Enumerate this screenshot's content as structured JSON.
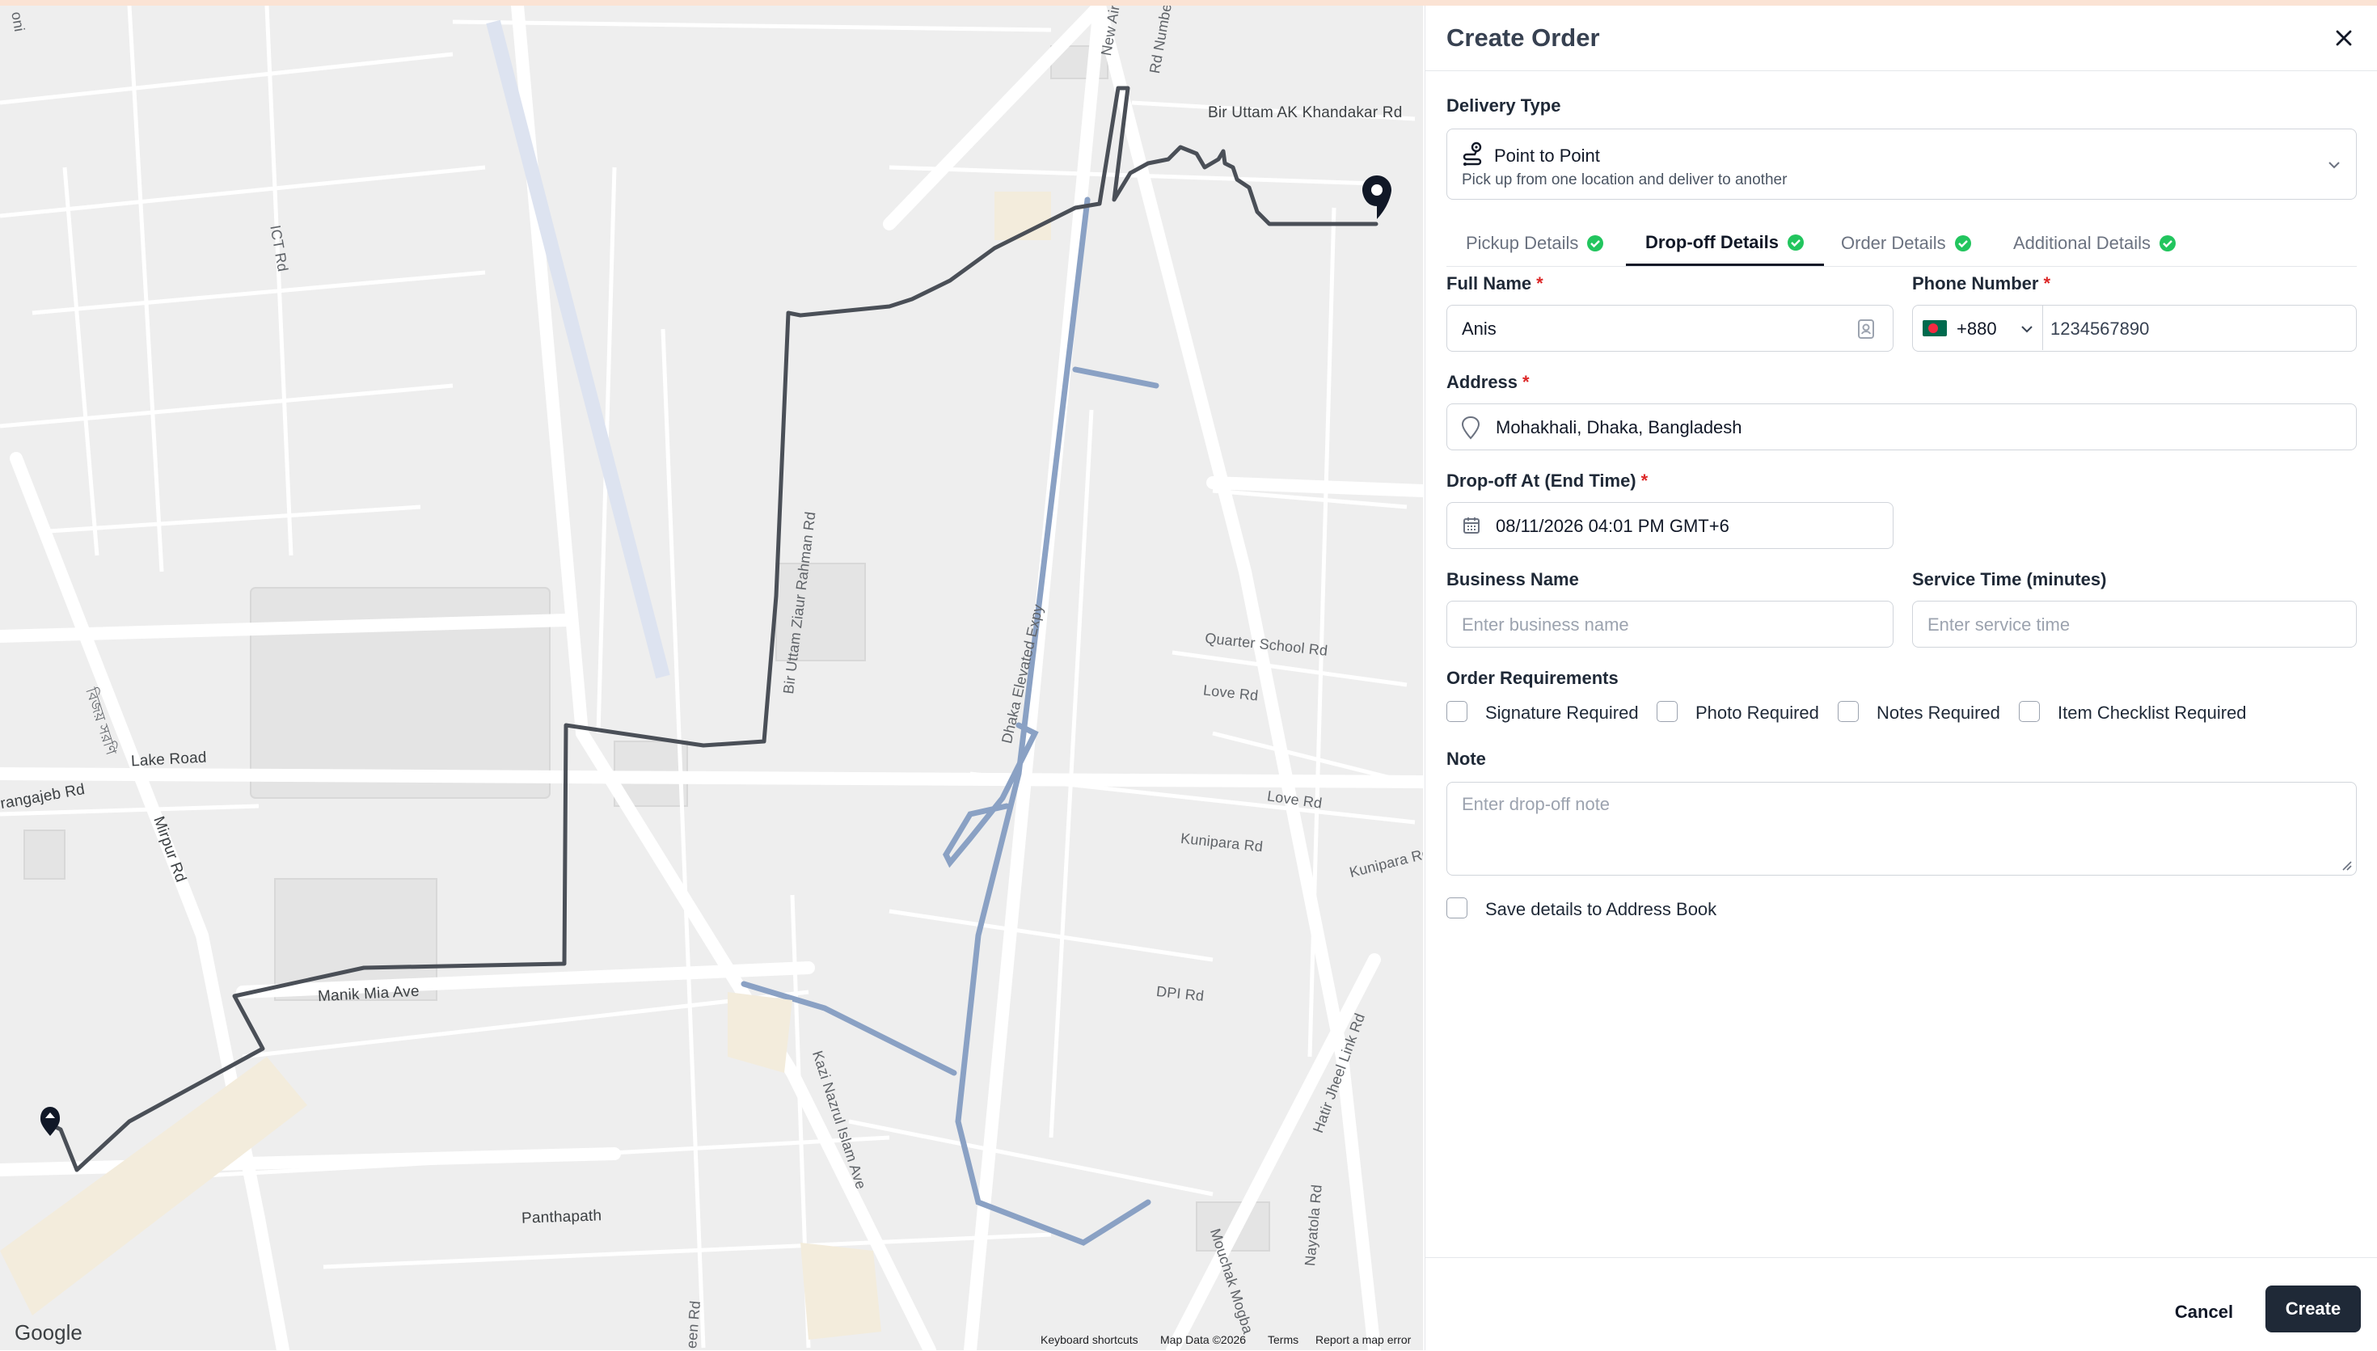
{
  "map": {
    "labels": {
      "bir_uttam_ak_khandakar_rd": "Bir Uttam AK Khandakar Rd",
      "new_airport_rd": "New Airport Rd",
      "rd_number": "Rd Number",
      "ict_rd": "ICT Rd",
      "bir_uttam_ziaur_rahman_rd": "Bir Uttam Ziaur Rahman Rd",
      "dhaka_elevated_expy": "Dhaka Elevated Expy",
      "quarter_school_rd": "Quarter School Rd",
      "love_rd_1": "Love Rd",
      "love_rd_2": "Love Rd",
      "kunipara_rd_1": "Kunipara Rd",
      "kunipara_rd_2": "Kunipara Rd",
      "lake_road": "Lake Road",
      "aurangajeb_rd": "rangajeb Rd",
      "mirpur_rd": "Mirpur Rd",
      "sarak": "বিজয় সরণি",
      "manik_mia_ave": "Manik Mia Ave",
      "dpi_rd": "DPI Rd",
      "hatir_jheel_link_rd": "Hatir Jheel Link Rd",
      "kazi_nazrul_islam_ave": "Kazi Nazrul Islam Ave",
      "panthapath": "Panthapath",
      "mouchak_mogbazar": "Mouchak Mogba",
      "nayatola_rd": "Nayatola Rd",
      "green_rd": "een Rd",
      "top_left_cut": "oni"
    },
    "google": "Google",
    "attribution": {
      "keyboard": "Keyboard shortcuts",
      "map_data": "Map Data ©2026",
      "terms": "Terms",
      "report": "Report a map error"
    },
    "route_color": "#4a4f57",
    "expressway_color": "#8aa1c4"
  },
  "panel": {
    "title": "Create Order",
    "delivery_type": {
      "label": "Delivery Type",
      "value_title": "Point to Point",
      "value_subtitle": "Pick up from one location and deliver to another"
    },
    "tabs": [
      {
        "label": "Pickup Details",
        "done": true
      },
      {
        "label": "Drop-off Details",
        "done": true,
        "active": true
      },
      {
        "label": "Order Details",
        "done": true
      },
      {
        "label": "Additional Details",
        "done": true
      }
    ],
    "full_name": {
      "label": "Full Name",
      "value": "Anis"
    },
    "phone": {
      "label": "Phone Number",
      "country_code": "+880",
      "value": "1234567890"
    },
    "address": {
      "label": "Address",
      "value": "Mohakhali, Dhaka, Bangladesh"
    },
    "dropoff_at": {
      "label": "Drop-off At (End Time)",
      "value": "08/11/2026 04:01 PM GMT+6"
    },
    "business_name": {
      "label": "Business Name",
      "placeholder": "Enter business name"
    },
    "service_time": {
      "label": "Service Time (minutes)",
      "placeholder": "Enter service time"
    },
    "requirements": {
      "label": "Order Requirements",
      "items": [
        "Signature Required",
        "Photo Required",
        "Notes Required",
        "Item Checklist Required"
      ]
    },
    "note": {
      "label": "Note",
      "placeholder": "Enter drop-off note"
    },
    "save_address": "Save details to Address Book",
    "cancel": "Cancel",
    "create": "Create",
    "accent_done": "#22c55e",
    "required_color": "#dc2626"
  }
}
